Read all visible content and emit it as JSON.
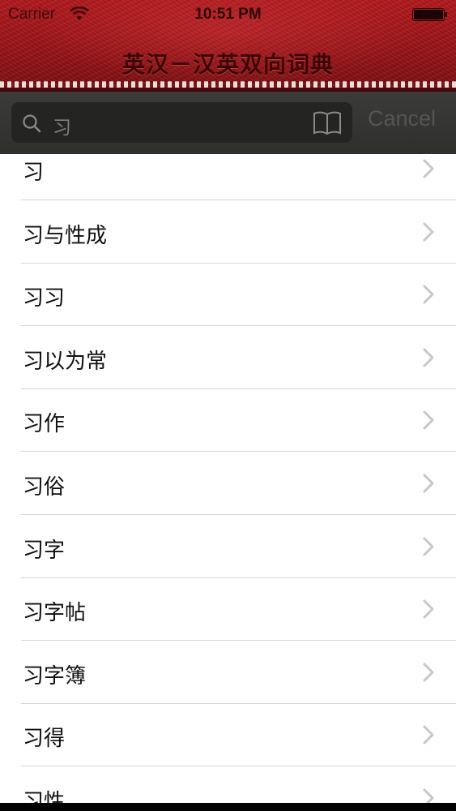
{
  "status_bar": {
    "carrier": "Carrier",
    "time": "10:51 PM",
    "wifi_icon": "wifi-icon",
    "battery_icon": "battery-icon"
  },
  "nav": {
    "title": "英汉－汉英双向词典"
  },
  "search": {
    "value": "习",
    "search_icon": "search-icon",
    "book_icon": "book-icon",
    "cancel_label": "Cancel"
  },
  "results": [
    {
      "label": "习"
    },
    {
      "label": "习与性成"
    },
    {
      "label": "习习"
    },
    {
      "label": "习以为常"
    },
    {
      "label": "习作"
    },
    {
      "label": "习俗"
    },
    {
      "label": "习字"
    },
    {
      "label": "习字帖"
    },
    {
      "label": "习字簿"
    },
    {
      "label": "习得"
    },
    {
      "label": "习性"
    }
  ],
  "colors": {
    "header_red": "#9e1418",
    "search_bar_bg": "#333431",
    "list_bg": "#ffffff",
    "chevron": "#c7c7cc"
  }
}
